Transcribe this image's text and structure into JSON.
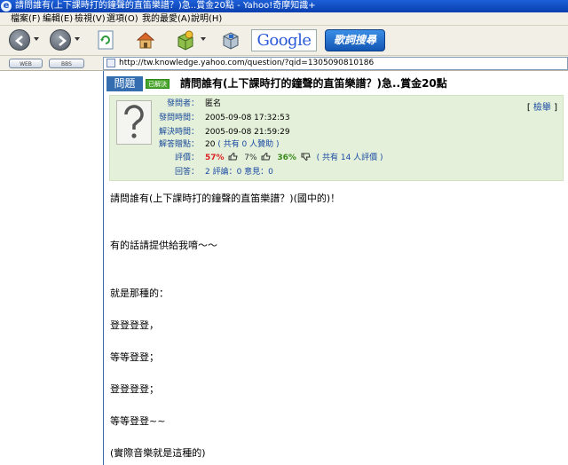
{
  "window": {
    "title": "請問誰有(上下課時打的鐘聲的直笛樂譜？)急..賞金20點 - Yahoo!奇摩知識+"
  },
  "menu": {
    "items": [
      "檔案(F)",
      "編輯(E)",
      "檢視(V)",
      "選項(O)",
      "我的最愛(A)",
      "說明(H)"
    ]
  },
  "toolbar": {
    "google_label": "Google",
    "lyric_search_label": "歌詞搜尋",
    "mini_buttons": [
      "WEB",
      "BBS"
    ]
  },
  "address": {
    "url": "http://tw.knowledge.yahoo.com/question/?qid=1305090810186"
  },
  "question": {
    "tab_label": "問題",
    "status_badge": "已解決",
    "title": "請問誰有(上下課時打的鐘聲的直笛樂譜？)急..賞金20點",
    "report_link": "檢舉",
    "fields": {
      "asker_label": "發問者：",
      "asker_value": "匿名",
      "ask_time_label": "發問時間：",
      "ask_time_value": "2005-09-08 17:32:53",
      "solve_time_label": "解決時間：",
      "solve_time_value": "2005-09-08 21:59:29",
      "points_label": "解答贈點：",
      "points_value": "20",
      "points_support": "( 共有 0 人贊助 )",
      "rating_label": "評價：",
      "rating_good": "57%",
      "rating_neutral": "7%",
      "rating_bad": "36%",
      "rating_total": "( 共有 14 人評價 )",
      "answers_label": "回答：",
      "answers_count": "2 評論：0 意見：0"
    },
    "body_lines": [
      "請問誰有(上下課時打的鐘聲的直笛樂譜？)(國中的)！",
      "有的話請提供給我唷～～",
      "就是那種的：",
      "登登登登，",
      "等等登登；",
      "登登登登；",
      "等等登登~~",
      "(實際音樂就是這種的)"
    ]
  }
}
